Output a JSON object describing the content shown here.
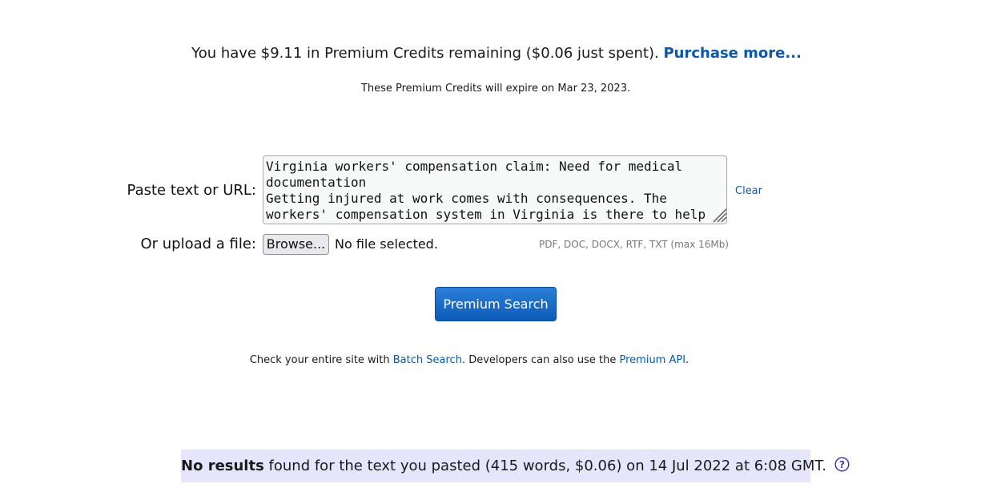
{
  "credits": {
    "text": "You have $9.11 in Premium Credits remaining ($0.06 just spent).",
    "purchase_link": "Purchase more...",
    "expire_text": "These Premium Credits will expire on Mar 23, 2023."
  },
  "form": {
    "paste_label": "Paste text or URL:",
    "text_value": "Virginia workers' compensation claim: Need for medical documentation\nGetting injured at work comes with consequences. The workers' compensation system in Virginia is there to help",
    "clear_link": "Clear",
    "upload_label": "Or upload a file:",
    "browse_button": "Browse...",
    "no_file_text": "No file selected.",
    "formats_hint": "PDF, DOC, DOCX, RTF, TXT (max 16Mb)",
    "submit_button": "Premium Search"
  },
  "batch": {
    "prefix": "Check your entire site with ",
    "batch_link": "Batch Search",
    "middle": ". Developers can also use the ",
    "api_link": "Premium API",
    "suffix": "."
  },
  "results": {
    "bold": "No results",
    "text": " found for the text you pasted (415 words, $0.06) on 14 Jul 2022 at 6:08 GMT.",
    "help_icon": "question-circle-icon"
  },
  "colors": {
    "link": "#0b58a8",
    "button": "#1466c4",
    "results_bg": "#e5e5fb",
    "help_icon": "#3b3bc9"
  }
}
